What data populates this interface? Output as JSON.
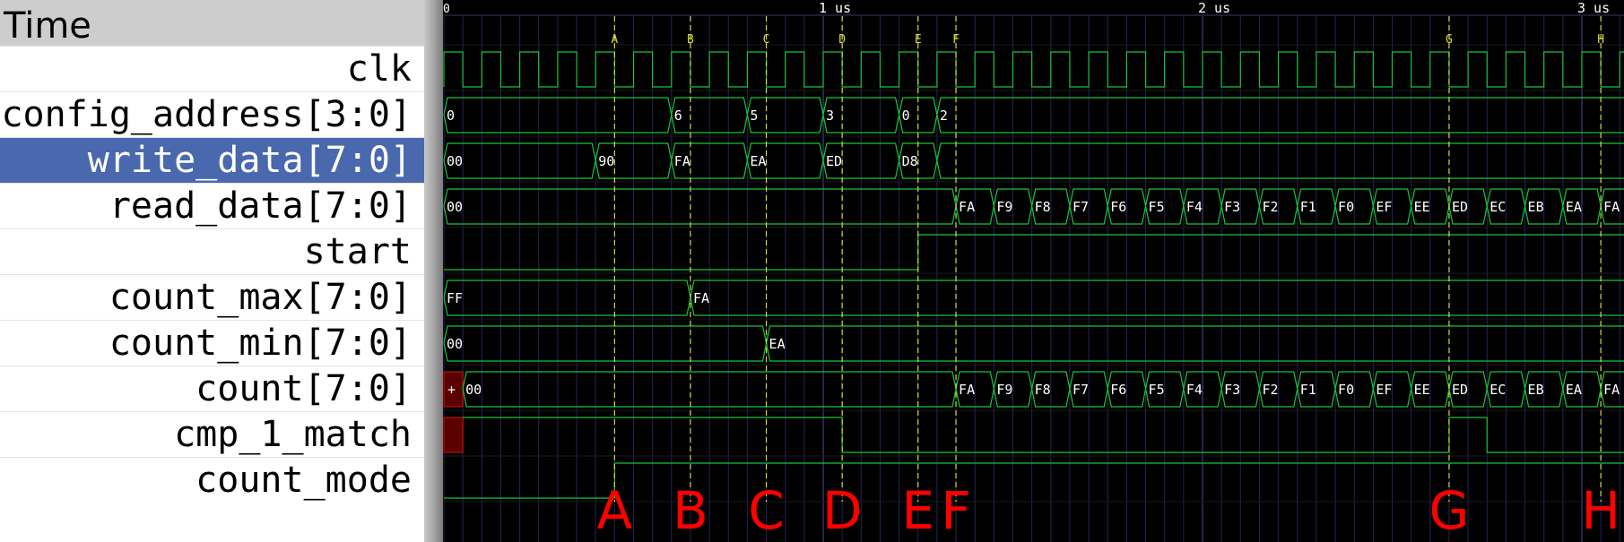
{
  "names_panel": {
    "header": "Time",
    "signals": [
      {
        "label": "clk"
      },
      {
        "label": "config_address[3:0]"
      },
      {
        "label": "write_data[7:0]",
        "selected": true
      },
      {
        "label": "read_data[7:0]"
      },
      {
        "label": "start"
      },
      {
        "label": "count_max[7:0]"
      },
      {
        "label": "count_min[7:0]"
      },
      {
        "label": "count[7:0]"
      },
      {
        "label": "cmp_1_match"
      },
      {
        "label": "count_mode"
      }
    ]
  },
  "timeline": {
    "start_label": "0",
    "ticks": [
      {
        "t": 1,
        "label": "1 us"
      },
      {
        "t": 2,
        "label": "2 us"
      },
      {
        "t": 3,
        "label": "3 us"
      }
    ],
    "t_max": 3.1,
    "clock_period_us": 0.1
  },
  "markers": [
    {
      "name": "A",
      "t": 0.45
    },
    {
      "name": "B",
      "t": 0.65
    },
    {
      "name": "C",
      "t": 0.85
    },
    {
      "name": "D",
      "t": 1.05
    },
    {
      "name": "E",
      "t": 1.25
    },
    {
      "name": "F",
      "t": 1.35
    },
    {
      "name": "G",
      "t": 2.65
    },
    {
      "name": "H",
      "t": 3.05
    }
  ],
  "colors": {
    "wave": "#19c43a",
    "marker": "#d8d83a",
    "marker_label": "#ff0000",
    "grid": "#24245a",
    "text": "#ffffff",
    "unknown_fill": "#5a0000",
    "unknown_stroke": "#d01818"
  },
  "waves": {
    "config_address": [
      {
        "t": 0,
        "v": "0"
      },
      {
        "t": 0.6,
        "v": "6"
      },
      {
        "t": 0.8,
        "v": "5"
      },
      {
        "t": 1.0,
        "v": "3"
      },
      {
        "t": 1.2,
        "v": "0"
      },
      {
        "t": 1.3,
        "v": "2"
      }
    ],
    "write_data": [
      {
        "t": 0,
        "v": "00"
      },
      {
        "t": 0.4,
        "v": "90"
      },
      {
        "t": 0.6,
        "v": "FA"
      },
      {
        "t": 0.8,
        "v": "EA"
      },
      {
        "t": 1.0,
        "v": "ED"
      },
      {
        "t": 1.2,
        "v": "D8"
      },
      {
        "t": 1.3,
        "v": ""
      }
    ],
    "read_data": [
      {
        "t": 0,
        "v": "00"
      },
      {
        "t": 1.35,
        "v": "FA"
      },
      {
        "t": 1.45,
        "v": "F9"
      },
      {
        "t": 1.55,
        "v": "F8"
      },
      {
        "t": 1.65,
        "v": "F7"
      },
      {
        "t": 1.75,
        "v": "F6"
      },
      {
        "t": 1.85,
        "v": "F5"
      },
      {
        "t": 1.95,
        "v": "F4"
      },
      {
        "t": 2.05,
        "v": "F3"
      },
      {
        "t": 2.15,
        "v": "F2"
      },
      {
        "t": 2.25,
        "v": "F1"
      },
      {
        "t": 2.35,
        "v": "F0"
      },
      {
        "t": 2.45,
        "v": "EF"
      },
      {
        "t": 2.55,
        "v": "EE"
      },
      {
        "t": 2.65,
        "v": "ED"
      },
      {
        "t": 2.75,
        "v": "EC"
      },
      {
        "t": 2.85,
        "v": "EB"
      },
      {
        "t": 2.95,
        "v": "EA"
      },
      {
        "t": 3.05,
        "v": "FA"
      }
    ],
    "start": [
      {
        "t": 0,
        "v": 0
      },
      {
        "t": 1.25,
        "v": 1
      }
    ],
    "count_max": [
      {
        "t": 0,
        "v": "FF"
      },
      {
        "t": 0.65,
        "v": "FA"
      }
    ],
    "count_min": [
      {
        "t": 0,
        "v": "00"
      },
      {
        "t": 0.85,
        "v": "EA"
      }
    ],
    "count_unknown_label": "+",
    "count": [
      {
        "t": 0.05,
        "v": "00"
      },
      {
        "t": 1.35,
        "v": "FA"
      },
      {
        "t": 1.45,
        "v": "F9"
      },
      {
        "t": 1.55,
        "v": "F8"
      },
      {
        "t": 1.65,
        "v": "F7"
      },
      {
        "t": 1.75,
        "v": "F6"
      },
      {
        "t": 1.85,
        "v": "F5"
      },
      {
        "t": 1.95,
        "v": "F4"
      },
      {
        "t": 2.05,
        "v": "F3"
      },
      {
        "t": 2.15,
        "v": "F2"
      },
      {
        "t": 2.25,
        "v": "F1"
      },
      {
        "t": 2.35,
        "v": "F0"
      },
      {
        "t": 2.45,
        "v": "EF"
      },
      {
        "t": 2.55,
        "v": "EE"
      },
      {
        "t": 2.65,
        "v": "ED"
      },
      {
        "t": 2.75,
        "v": "EC"
      },
      {
        "t": 2.85,
        "v": "EB"
      },
      {
        "t": 2.95,
        "v": "EA"
      },
      {
        "t": 3.05,
        "v": "FA"
      }
    ],
    "cmp_1_match": [
      {
        "t": 0.05,
        "v": 1
      },
      {
        "t": 1.05,
        "v": 0
      },
      {
        "t": 2.65,
        "v": 1
      },
      {
        "t": 2.75,
        "v": 0
      }
    ],
    "count_mode": [
      {
        "t": 0,
        "v": 0
      },
      {
        "t": 0.45,
        "v": 1
      }
    ]
  }
}
